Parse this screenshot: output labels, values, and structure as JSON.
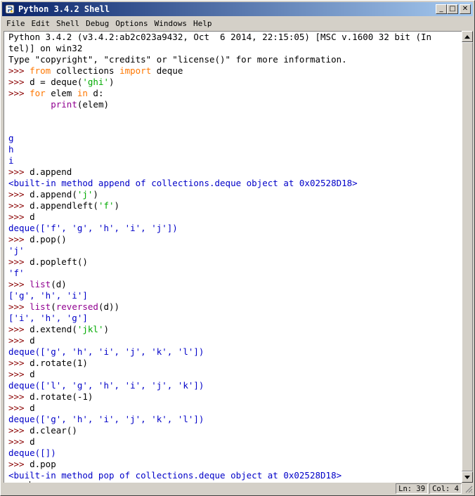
{
  "window": {
    "title": "Python 3.4.2 Shell",
    "icon": "python-idle-icon",
    "controls": {
      "minimize": "_",
      "maximize": "□",
      "close": "✕"
    }
  },
  "menubar": [
    "File",
    "Edit",
    "Shell",
    "Debug",
    "Options",
    "Windows",
    "Help"
  ],
  "shell": {
    "banner": [
      "Python 3.4.2 (v3.4.2:ab2c023a9432, Oct  6 2014, 22:15:05) [MSC v.1600 32 bit (In",
      "tel)] on win32",
      "Type \"copyright\", \"credits\" or \"license()\" for more information."
    ],
    "prompt": ">>> ",
    "lines": [
      ">>> from collections import deque",
      ">>> d = deque('ghi')",
      ">>> for elem in d:",
      "        print(elem)",
      "",
      "",
      "g",
      "h",
      "i",
      ">>> d.append",
      "<built-in method append of collections.deque object at 0x02528D18>",
      ">>> d.append('j')",
      ">>> d.appendleft('f')",
      ">>> d",
      "deque(['f', 'g', 'h', 'i', 'j'])",
      ">>> d.pop()",
      "'j'",
      ">>> d.popleft()",
      "'f'",
      ">>> list(d)",
      "['g', 'h', 'i']",
      ">>> list(reversed(d))",
      "['i', 'h', 'g']",
      ">>> d.extend('jkl')",
      ">>> d",
      "deque(['g', 'h', 'i', 'j', 'k', 'l'])",
      ">>> d.rotate(1)",
      ">>> d",
      "deque(['l', 'g', 'h', 'i', 'j', 'k'])",
      ">>> d.rotate(-1)",
      ">>> d",
      "deque(['g', 'h', 'i', 'j', 'k', 'l'])",
      ">>> d.clear()",
      ">>> d",
      "deque([])",
      ">>> d.pop",
      "<built-in method pop of collections.deque object at 0x02528D18>",
      ">>> "
    ]
  },
  "statusbar": {
    "line": "Ln: 39",
    "col": "Col: 4"
  },
  "colors": {
    "titlebar_start": "#0a246a",
    "titlebar_end": "#a6caf0",
    "output": "#0000c8",
    "keyword": "#ff7700",
    "string": "#00aa00",
    "builtin": "#900090",
    "prompt": "#8a0000"
  }
}
